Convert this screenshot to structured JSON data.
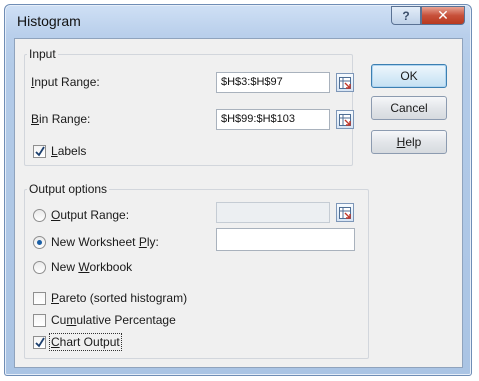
{
  "window": {
    "title": "Histogram",
    "help_glyph": "?",
    "close_glyph": "✕"
  },
  "input_group": {
    "legend": "Input",
    "input_range": {
      "label_mnemonic": "I",
      "label_rest": "nput Range:",
      "value": "$H$3:$H$97"
    },
    "bin_range": {
      "label_mnemonic": "B",
      "label_rest": "in Range:",
      "value": "$H$99:$H$103"
    },
    "labels_checkbox": {
      "label_mnemonic": "L",
      "label_rest": "abels",
      "checked": true
    }
  },
  "buttons": {
    "ok": "OK",
    "cancel": "Cancel",
    "help_mnemonic": "H",
    "help_rest": "elp"
  },
  "output_group": {
    "legend": "Output options",
    "output_range": {
      "label_mnemonic": "O",
      "label_rest": "utput Range:",
      "value": "",
      "selected": false,
      "enabled": false
    },
    "new_worksheet": {
      "label_pre": "New Worksheet ",
      "label_mnemonic": "P",
      "label_rest": "ly:",
      "value": "",
      "selected": true
    },
    "new_workbook": {
      "label_pre": "New ",
      "label_mnemonic": "W",
      "label_rest": "orkbook",
      "selected": false
    }
  },
  "options": {
    "pareto": {
      "label_mnemonic": "P",
      "label_rest": "areto (sorted histogram)",
      "checked": false
    },
    "cumulative": {
      "label_pre": "Cu",
      "label_mnemonic": "m",
      "label_rest": "ulative Percentage",
      "checked": false
    },
    "chart_output": {
      "label_mnemonic": "C",
      "label_rest": "hart Output",
      "checked": true
    }
  },
  "icons": {
    "range_selector": "range-selector-icon",
    "check": "checkmark-icon"
  }
}
